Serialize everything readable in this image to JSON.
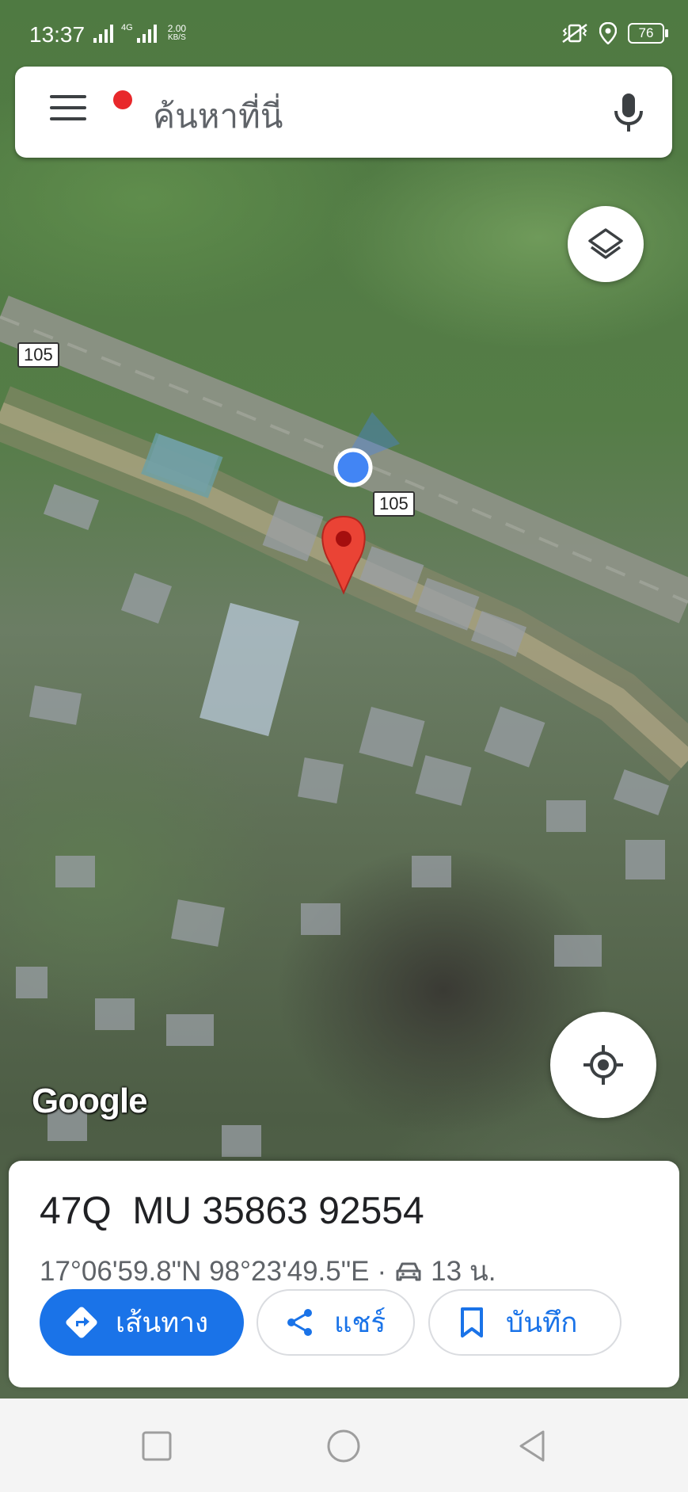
{
  "status_bar": {
    "time": "13:37",
    "network_type": "4G",
    "net_speed_value": "2.00",
    "net_speed_unit": "KB/S",
    "battery": "76",
    "icons": [
      "signal-icon",
      "signal-4g-icon",
      "vibrate-icon",
      "location-icon",
      "battery-icon"
    ]
  },
  "search": {
    "placeholder": "ค้นหาที่นี่",
    "menu_icon": "hamburger-menu-icon",
    "mic_icon": "microphone-icon"
  },
  "map": {
    "road_shields": [
      "105",
      "105"
    ],
    "logo": "Google",
    "colors": {
      "pin": "#ea4335",
      "my_location": "#4285f4"
    }
  },
  "controls": {
    "layers_icon": "layers-icon",
    "locate_icon": "my-location-icon"
  },
  "place_card": {
    "title": "47Q  MU 35863 92554",
    "coordinates": "17°06'59.8\"N 98°23'49.5\"E",
    "separator": "·",
    "travel_time": "13 น.",
    "actions": {
      "directions": "เส้นทาง",
      "share": "แชร์",
      "save": "บันทึก"
    },
    "accent_color": "#1a73e8"
  },
  "nav_bar": {
    "icons": [
      "recents-square-icon",
      "home-circle-icon",
      "back-triangle-icon"
    ]
  }
}
